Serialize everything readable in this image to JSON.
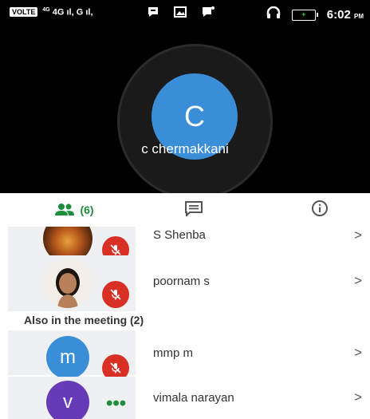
{
  "status_bar": {
    "volte": "VOLTE",
    "network": "4G",
    "network_sup": "4G",
    "time": "6:02",
    "time_suffix": "PM",
    "icons": [
      "signal-icon",
      "message-bubble-icon",
      "gallery-icon",
      "notification-icon",
      "headphones-icon",
      "battery-icon"
    ]
  },
  "video_tile": {
    "initial": "C",
    "name": "c chermakkani",
    "avatar_color": "#3a8ed8"
  },
  "tabs": {
    "people_count": "(6)",
    "active": "people",
    "active_color": "#1e8e3e"
  },
  "participants": [
    {
      "name": "S Shenba",
      "mic": "muted",
      "avatar": "photo"
    },
    {
      "name": "poornam s",
      "mic": "muted",
      "avatar": "photo"
    }
  ],
  "also_in_meeting": {
    "label": "Also in the meeting (2)",
    "people": [
      {
        "initial": "m",
        "name": "mmp m",
        "mic": "muted",
        "color": "#3a8ed8"
      },
      {
        "initial": "v",
        "name": "vimala narayan",
        "mic": "speaking",
        "color": "#673ab7"
      }
    ]
  },
  "chevron": ">"
}
